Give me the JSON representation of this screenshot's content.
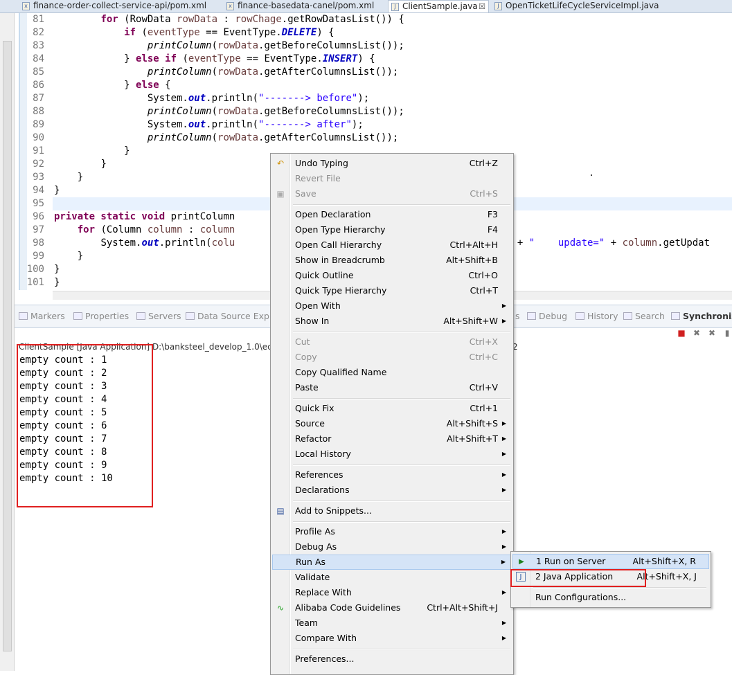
{
  "tabs": [
    {
      "label": "finance-order-collect-service-api/pom.xml",
      "icon": "xml-file-icon"
    },
    {
      "label": "finance-basedata-canel/pom.xml",
      "icon": "xml-file-icon"
    },
    {
      "label": "ClientSample.java",
      "icon": "java-file-icon",
      "close": "☒"
    },
    {
      "label": "OpenTicketLifeCycleServiceImpl.java",
      "icon": "java-file-icon"
    }
  ],
  "code": {
    "line_numbers": [
      "81",
      "82",
      "83",
      "84",
      "85",
      "86",
      "87",
      "88",
      "89",
      "90",
      "91",
      "92",
      "93",
      "94",
      "95",
      "96",
      "97",
      "98",
      "99",
      "100",
      "101"
    ],
    "l81_for": "for",
    "l81_a": " (RowData ",
    "l81_var": "rowData",
    "l81_b": " : ",
    "l81_var2": "rowChage",
    "l81_c": ".getRowDatasList()) {",
    "l82_if": "if",
    "l82_a": " (",
    "l82_var": "eventType",
    "l82_b": " == EventType.",
    "l82_fld": "DELETE",
    "l82_c": ") {",
    "l83_m": "printColumn",
    "l83_a": "(",
    "l83_var": "rowData",
    "l83_b": ".getBeforeColumnsList());",
    "l84_a": "} ",
    "l84_else": "else if",
    "l84_b": " (",
    "l84_var": "eventType",
    "l84_c": " == EventType.",
    "l84_fld": "INSERT",
    "l84_d": ") {",
    "l85_m": "printColumn",
    "l85_a": "(",
    "l85_var": "rowData",
    "l85_b": ".getAfterColumnsList());",
    "l86_a": "} ",
    "l86_else": "else",
    "l86_b": " {",
    "l87_a": "System.",
    "l87_fld": "out",
    "l87_b": ".println(",
    "l87_str": "\"-------> before\"",
    "l87_c": ");",
    "l88_m": "printColumn",
    "l88_a": "(",
    "l88_var": "rowData",
    "l88_b": ".getBeforeColumnsList());",
    "l89_a": "System.",
    "l89_fld": "out",
    "l89_b": ".println(",
    "l89_str": "\"-------> after\"",
    "l89_c": ");",
    "l90_m": "printColumn",
    "l90_a": "(",
    "l90_var": "rowData",
    "l90_b": ".getAfterColumnsList());",
    "l91": "}",
    "l92": "}",
    "l93": "}",
    "l94": "}",
    "l96_kw": "private static void",
    "l96_a": " printColumn",
    "l97_for": "for",
    "l97_a": " (Column ",
    "l97_var": "column",
    "l97_b": " : ",
    "l97_var2": "column",
    "l98_a": "System.",
    "l98_fld": "out",
    "l98_b": ".println(",
    "l98_var": "colu",
    "l98_c": ") + ",
    "l98_str": "\"    update=\"",
    "l98_d": " + ",
    "l98_var2": "column",
    "l98_e": ".getUpdat",
    "l99": "}",
    "l100": "}",
    "l101": "}"
  },
  "views": [
    {
      "label": "Markers",
      "icon": "markers-icon"
    },
    {
      "label": "Properties",
      "icon": "properties-icon"
    },
    {
      "label": "Servers",
      "icon": "servers-icon"
    },
    {
      "label": "Data Source Explo",
      "icon": "data-source-icon"
    },
    {
      "label": "s",
      "icon": ""
    },
    {
      "label": "Debug",
      "icon": "debug-icon"
    },
    {
      "label": "History",
      "icon": "history-icon"
    },
    {
      "label": "Search",
      "icon": "search-icon"
    },
    {
      "label": "Synchroniz",
      "icon": "synchronize-icon"
    }
  ],
  "console": {
    "title": "ClientSample [Java Application] D:\\banksteel_develop_1.0\\eclip",
    "title_tail": "2",
    "lines": [
      "empty count : 1",
      "empty count : 2",
      "empty count : 3",
      "empty count : 4",
      "empty count : 5",
      "empty count : 6",
      "empty count : 7",
      "empty count : 8",
      "empty count : 9",
      "empty count : 10"
    ]
  },
  "menu": {
    "items": [
      {
        "label": "Undo Typing",
        "shortcut": "Ctrl+Z",
        "icon": "undo-icon"
      },
      {
        "label": "Revert File",
        "shortcut": "",
        "disabled": true
      },
      {
        "label": "Save",
        "shortcut": "Ctrl+S",
        "disabled": true,
        "icon": "save-icon"
      },
      {
        "label": "Open Declaration",
        "shortcut": "F3"
      },
      {
        "label": "Open Type Hierarchy",
        "shortcut": "F4"
      },
      {
        "label": "Open Call Hierarchy",
        "shortcut": "Ctrl+Alt+H"
      },
      {
        "label": "Show in Breadcrumb",
        "shortcut": "Alt+Shift+B"
      },
      {
        "label": "Quick Outline",
        "shortcut": "Ctrl+O"
      },
      {
        "label": "Quick Type Hierarchy",
        "shortcut": "Ctrl+T"
      },
      {
        "label": "Open With",
        "shortcut": "",
        "submenu": true
      },
      {
        "label": "Show In",
        "shortcut": "Alt+Shift+W",
        "submenu": true
      },
      {
        "label": "Cut",
        "shortcut": "Ctrl+X",
        "disabled": true
      },
      {
        "label": "Copy",
        "shortcut": "Ctrl+C",
        "disabled": true
      },
      {
        "label": "Copy Qualified Name",
        "shortcut": ""
      },
      {
        "label": "Paste",
        "shortcut": "Ctrl+V"
      },
      {
        "label": "Quick Fix",
        "shortcut": "Ctrl+1"
      },
      {
        "label": "Source",
        "shortcut": "Alt+Shift+S",
        "submenu": true
      },
      {
        "label": "Refactor",
        "shortcut": "Alt+Shift+T",
        "submenu": true
      },
      {
        "label": "Local History",
        "shortcut": "",
        "submenu": true
      },
      {
        "label": "References",
        "shortcut": "",
        "submenu": true
      },
      {
        "label": "Declarations",
        "shortcut": "",
        "submenu": true
      },
      {
        "label": "Add to Snippets...",
        "shortcut": "",
        "icon": "snippets-icon"
      },
      {
        "label": "Profile As",
        "shortcut": "",
        "submenu": true
      },
      {
        "label": "Debug As",
        "shortcut": "",
        "submenu": true
      },
      {
        "label": "Run As",
        "shortcut": "",
        "submenu": true,
        "highlighted": true
      },
      {
        "label": "Validate",
        "shortcut": ""
      },
      {
        "label": "Replace With",
        "shortcut": "",
        "submenu": true
      },
      {
        "label": "Alibaba Code Guidelines",
        "shortcut": "Ctrl+Alt+Shift+J",
        "icon": "alibaba-icon"
      },
      {
        "label": "Team",
        "shortcut": "",
        "submenu": true
      },
      {
        "label": "Compare With",
        "shortcut": "",
        "submenu": true
      },
      {
        "label": "Preferences...",
        "shortcut": ""
      }
    ]
  },
  "submenu": {
    "items": [
      {
        "label": "1 Run on Server",
        "shortcut": "Alt+Shift+X, R",
        "icon": "run-server-icon"
      },
      {
        "label": "2 Java Application",
        "shortcut": "Alt+Shift+X, J",
        "icon": "java-app-icon"
      },
      {
        "label": "Run Configurations...",
        "shortcut": ""
      }
    ]
  },
  "colors": {
    "highlight_box": "#e02020",
    "menu_highlight": "#d5e4f7"
  }
}
